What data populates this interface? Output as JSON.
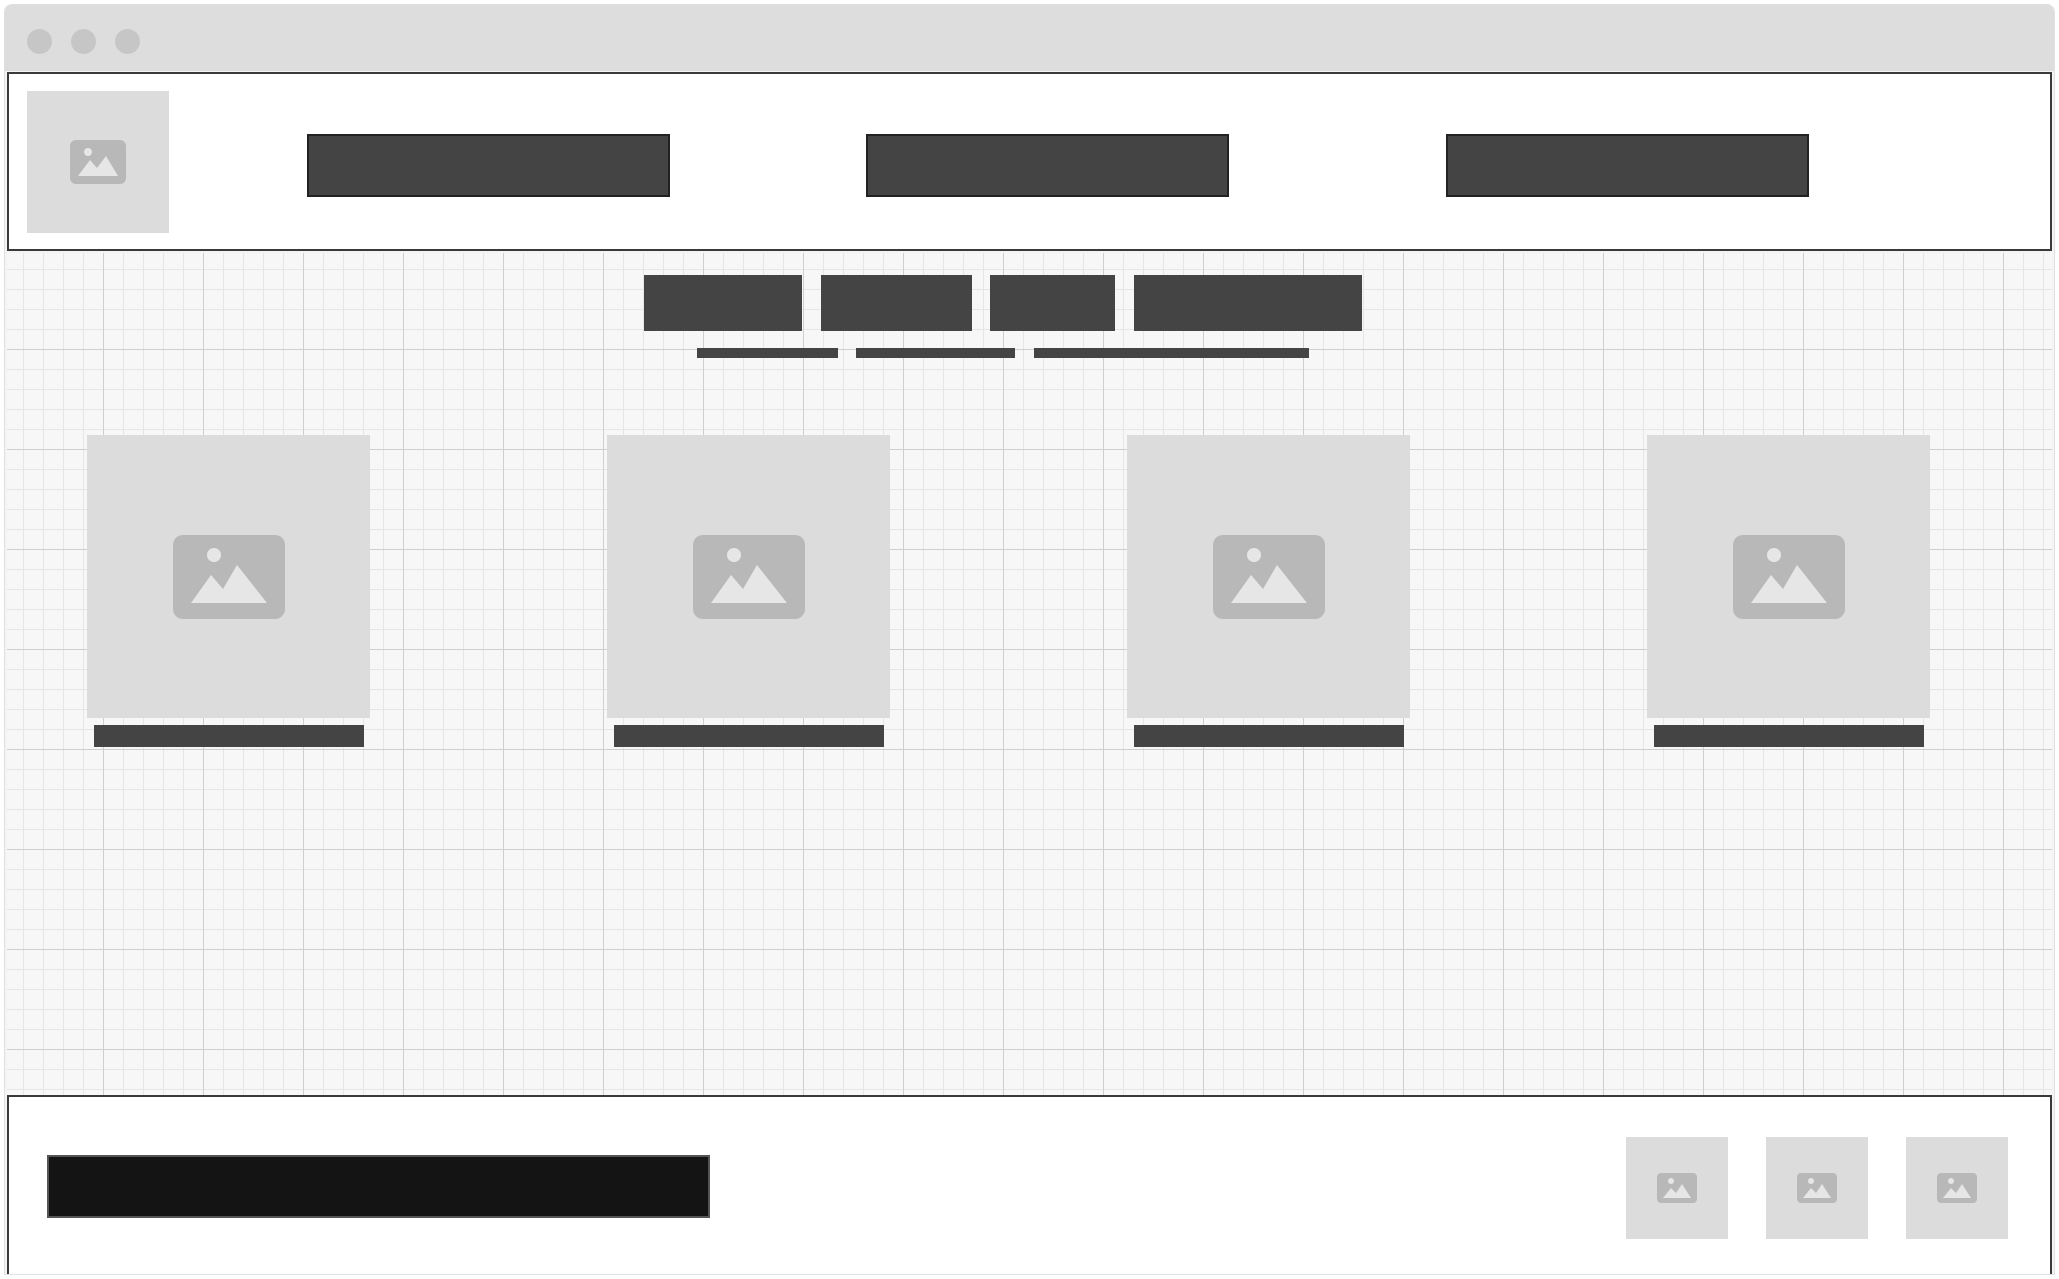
{
  "window": {
    "controls": [
      "close-dot",
      "minimize-dot",
      "maximize-dot"
    ]
  },
  "header": {
    "logo_icon": "image-placeholder-icon",
    "nav": [
      {
        "label": ""
      },
      {
        "label": ""
      },
      {
        "label": ""
      }
    ]
  },
  "main": {
    "tabs": [
      {
        "label": ""
      },
      {
        "label": ""
      },
      {
        "label": ""
      },
      {
        "label": ""
      }
    ],
    "underlines": 3,
    "cards": [
      {
        "image_icon": "image-placeholder-icon",
        "caption": ""
      },
      {
        "image_icon": "image-placeholder-icon",
        "caption": ""
      },
      {
        "image_icon": "image-placeholder-icon",
        "caption": ""
      },
      {
        "image_icon": "image-placeholder-icon",
        "caption": ""
      }
    ]
  },
  "footer": {
    "bar_text": "",
    "thumbs": [
      {
        "icon": "image-placeholder-icon"
      },
      {
        "icon": "image-placeholder-icon"
      },
      {
        "icon": "image-placeholder-icon"
      }
    ]
  },
  "colors": {
    "placeholder_bg": "#dcdcdc",
    "placeholder_icon": "#b8b8b8",
    "bar_dark": "#444444",
    "footer_bar": "#141414",
    "border": "#3a3a3a",
    "titlebar": "#dddddd"
  }
}
